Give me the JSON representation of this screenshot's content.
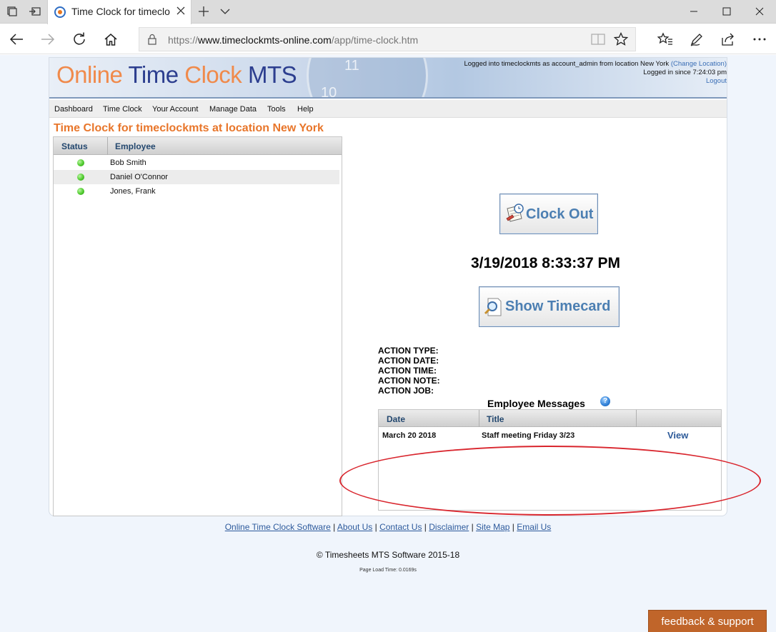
{
  "browser": {
    "tab_title": "Time Clock for timecloc",
    "url_prefix": "https://",
    "url_domain": "www.timeclockmts-online.com",
    "url_path": "/app/time-clock.htm"
  },
  "header": {
    "logo_part1": "Online",
    "logo_part2": "Time",
    "logo_part3": "Clock",
    "logo_part4": "MTS",
    "login_line1": "Logged into timeclockmts as account_admin from location New York",
    "change_location": "(Change Location)",
    "login_line2": "Logged in since 7:24:03 pm",
    "logout": "Logout",
    "logo_colors": {
      "orange": "#f08a4b",
      "blue": "#2c3e8f"
    }
  },
  "menu": [
    "Dashboard",
    "Time Clock",
    "Your Account",
    "Manage Data",
    "Tools",
    "Help"
  ],
  "page_title": "Time Clock for timeclockmts at location New York",
  "employees": {
    "status_header": "Status",
    "employee_header": "Employee",
    "rows": [
      {
        "name": "Bob Smith",
        "status": "green"
      },
      {
        "name": "Daniel O'Connor",
        "status": "green"
      },
      {
        "name": "Jones, Frank",
        "status": "green"
      }
    ]
  },
  "clock": {
    "clock_out_label": "Clock Out",
    "datetime": "3/19/2018 8:33:37 PM",
    "show_timecard_label": "Show Timecard"
  },
  "actions": {
    "type": "ACTION TYPE:",
    "date": "ACTION DATE:",
    "time": "ACTION TIME:",
    "note": "ACTION NOTE:",
    "job": "ACTION JOB:"
  },
  "messages": {
    "title": "Employee Messages",
    "help": "?",
    "date_header": "Date",
    "title_header": "Title",
    "rows": [
      {
        "date": "March 20 2018",
        "title": "Staff meeting Friday 3/23",
        "view": "View"
      }
    ]
  },
  "footer": {
    "links": [
      "Online Time Clock Software",
      "About Us",
      "Contact Us",
      "Disclaimer",
      "Site Map",
      "Email Us"
    ],
    "separator": "|",
    "copyright": "© Timesheets MTS Software 2015-18",
    "load_time": "Page Load Time: 0.0169s"
  },
  "feedback_label": "feedback & support",
  "colors": {
    "accent_orange": "#e8762b",
    "link_blue": "#2d5a9c",
    "highlight_red": "#d9262e",
    "feedback_bg": "#c0652a"
  }
}
